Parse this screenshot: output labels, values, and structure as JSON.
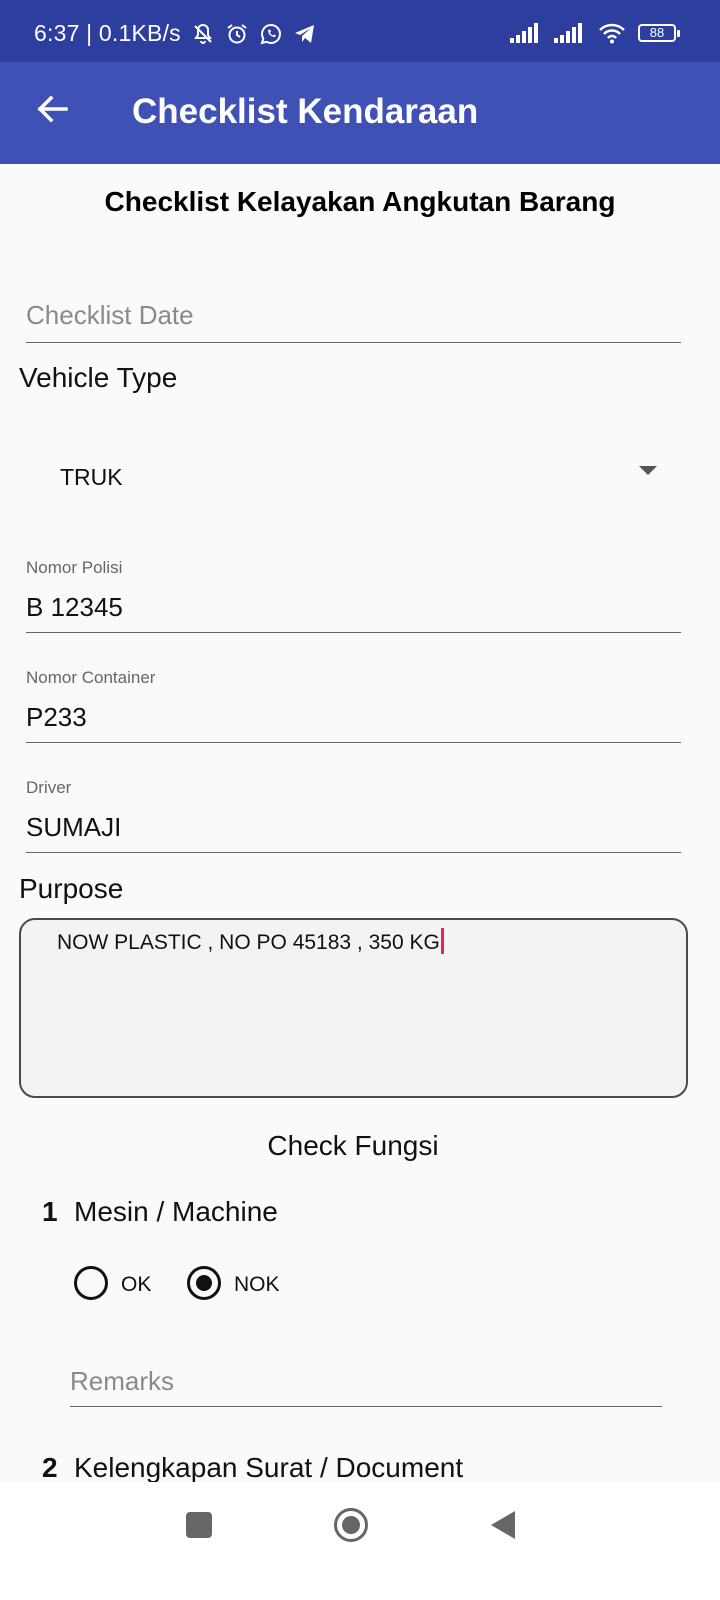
{
  "status_bar": {
    "time_speed": "6:37 | 0.1KB/s",
    "battery": "88",
    "icons": [
      "mute-notification-icon",
      "alarm-icon",
      "whatsapp-icon",
      "telegram-icon",
      "signal-icon",
      "signal-icon",
      "wifi-icon",
      "battery-icon"
    ]
  },
  "app_bar": {
    "title": "Checklist Kendaraan",
    "back_icon": "arrow-left-icon"
  },
  "form": {
    "title": "Checklist Kelayakan Angkutan Barang",
    "checklist_date": {
      "placeholder": "Checklist Date",
      "value": ""
    },
    "vehicle_type": {
      "label": "Vehicle Type",
      "selected": "TRUK"
    },
    "nomor_polisi": {
      "label": "Nomor Polisi",
      "value": "B 12345"
    },
    "nomor_container": {
      "label": "Nomor Container",
      "value": "P233"
    },
    "driver": {
      "label": "Driver",
      "value": "SUMAJI"
    },
    "purpose": {
      "label": "Purpose",
      "value": "NOW PLASTIC , NO PO 45183 , 350 KG"
    }
  },
  "check_fungsi": {
    "title": "Check Fungsi",
    "items": [
      {
        "number": "1",
        "name": "Mesin / Machine",
        "options": [
          "OK",
          "NOK"
        ],
        "selected": "NOK",
        "remarks_placeholder": "Remarks"
      },
      {
        "number": "2",
        "name": "Kelengkapan Surat / Document"
      }
    ]
  },
  "nav_bar": {
    "icons": [
      "recent-apps-icon",
      "home-icon",
      "back-icon"
    ]
  },
  "colors": {
    "status_bar": "#2e3e9e",
    "app_bar": "#3f51b5",
    "background": "#fafafa",
    "cursor": "#e91e63"
  }
}
